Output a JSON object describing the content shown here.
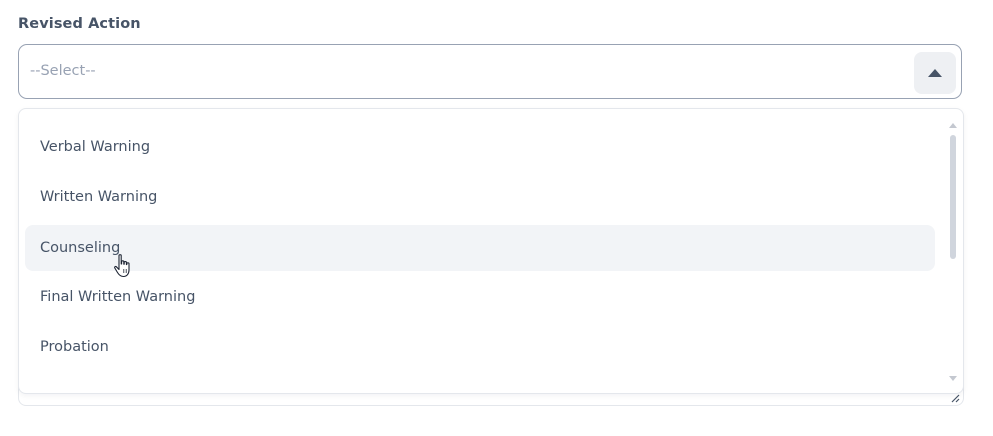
{
  "field": {
    "label": "Revised Action",
    "placeholder": "--Select--",
    "expanded": true
  },
  "options": [
    {
      "label": "Verbal Warning",
      "hovered": false
    },
    {
      "label": "Written Warning",
      "hovered": false
    },
    {
      "label": "Counseling",
      "hovered": true
    },
    {
      "label": "Final Written Warning",
      "hovered": false
    },
    {
      "label": "Probation",
      "hovered": false
    }
  ],
  "icons": {
    "toggle": "caret-up-icon",
    "cursor": "hand-pointer-icon",
    "resize": "resize-grip-icon"
  },
  "colors": {
    "text": "#475467",
    "placeholder": "#98a2b3",
    "hover_bg": "#f2f4f7",
    "border": "#98a2b3"
  }
}
